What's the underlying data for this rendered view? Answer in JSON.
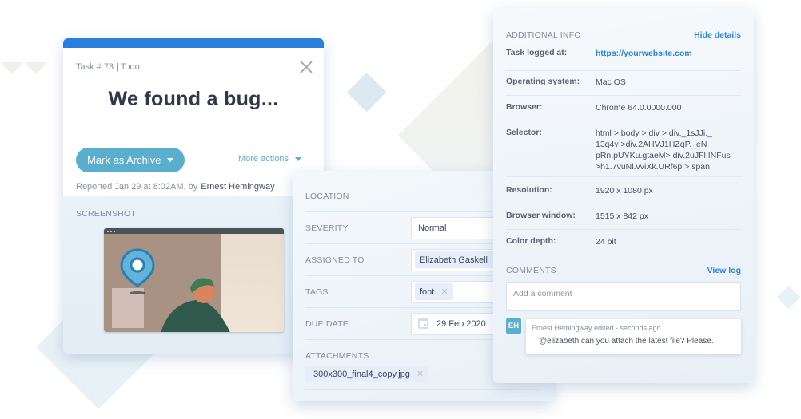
{
  "task_card": {
    "meta": "Task # 73 | Todo",
    "title": "We found a bug...",
    "primary_action": "Mark as Archive",
    "more_actions": "More actions",
    "reported_prefix": "Reported Jan 29 at 8:02AM, by",
    "reported_author": "Ernest Hemingway",
    "screenshot_label": "SCREENSHOT",
    "accent_color": "#2a7ee0",
    "button_color": "#5aafcf"
  },
  "details_card": {
    "location_label": "LOCATION",
    "severity_label": "SEVERITY",
    "severity_value": "Normal",
    "assigned_label": "ASSIGNED TO",
    "assigned_value": "Elizabeth Gaskell",
    "tags_label": "TAGS",
    "tags": [
      "font"
    ],
    "due_label": "DUE DATE",
    "due_value": "29 Feb 2020",
    "attachments_label": "ATTACHMENTS",
    "attachments": [
      "300x300_final4_copy.jpg"
    ]
  },
  "info_card": {
    "heading": "ADDITIONAL INFO",
    "hide_link": "Hide details",
    "rows": [
      {
        "key": "Task logged at:",
        "value": "https://yourwebsite.com"
      },
      {
        "key": "Operating system:",
        "value": "Mac OS"
      },
      {
        "key": "Browser:",
        "value": "Chrome 64.0.0000.000"
      },
      {
        "key": "Selector:",
        "value": "html > body > div > div._1sJJi._13q4y >div.2AHVJ1HZqP._eNpRn.pUYKu.gtaeM> div.2uJFl.INFus >h1.7vuNl.vviXk.URf6p > span"
      },
      {
        "key": "Resolution:",
        "value": "1920 x 1080 px"
      },
      {
        "key": "Browser window:",
        "value": "1515 x 842 px"
      },
      {
        "key": "Color depth:",
        "value": "24 bit"
      }
    ],
    "selector_lines": [
      "html > body > div > div._1sJJi._",
      "13q4y >div.2AHVJ1HZqP._eN",
      "pRn.pUYKu.gtaeM> div.2uJFl.INFus",
      ">h1.7vuNl.vviXk.URf6p > span"
    ],
    "comments_label": "COMMENTS",
    "view_log": "View log",
    "comment_placeholder": "Add a comment",
    "comment": {
      "avatar": "EH",
      "meta": "Ernest Hemingway edited - seconds ago",
      "text": "@elizabeth can you attach the latest file? Please."
    }
  }
}
